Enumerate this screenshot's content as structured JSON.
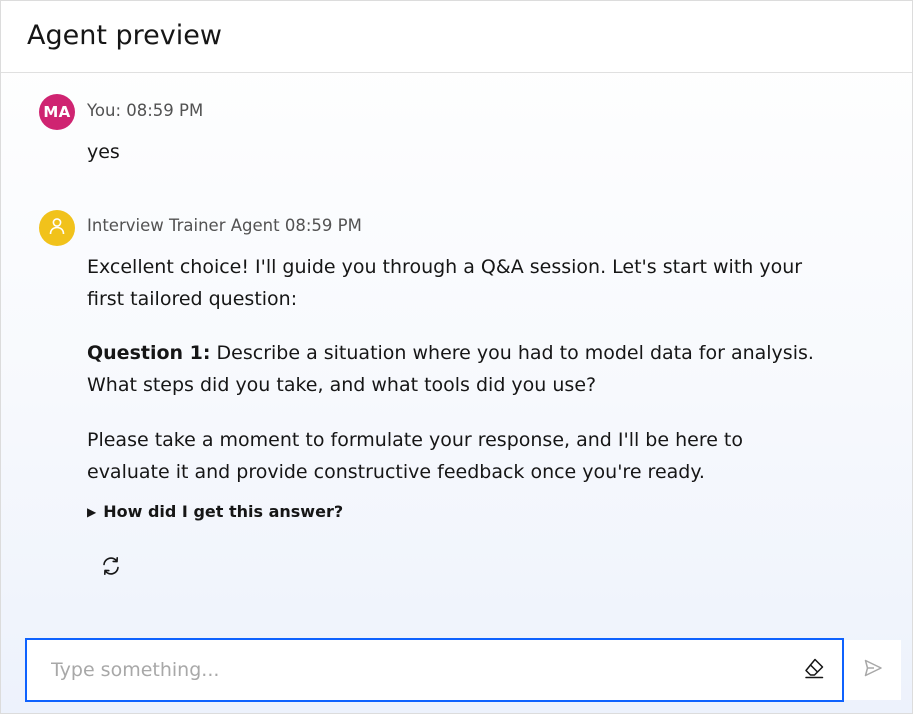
{
  "header": {
    "title": "Agent preview"
  },
  "messages": [
    {
      "avatar_initials": "MA",
      "meta": "You: 08:59 PM",
      "text": "yes"
    },
    {
      "avatar_icon": "user-icon",
      "meta": "Interview Trainer Agent 08:59 PM",
      "para1": "Excellent choice! I'll guide you through a Q&A session. Let's start with your first tailored question:",
      "question_label": "Question 1:",
      "question_text": " Describe a situation where you had to model data for analysis. What steps did you take, and what tools did you use?",
      "para3": "Please take a moment to formulate your response, and I'll be here to evaluate it and provide constructive feedback once you're ready.",
      "details_label": "How did I get this answer?",
      "regenerate_icon": "refresh-icon"
    }
  ],
  "composer": {
    "placeholder": "Type something...",
    "value": "",
    "clear_icon": "eraser-icon",
    "send_icon": "send-icon"
  },
  "colors": {
    "user_avatar": "#cf2471",
    "agent_avatar": "#f1c21b",
    "input_focus": "#0f62fe"
  }
}
